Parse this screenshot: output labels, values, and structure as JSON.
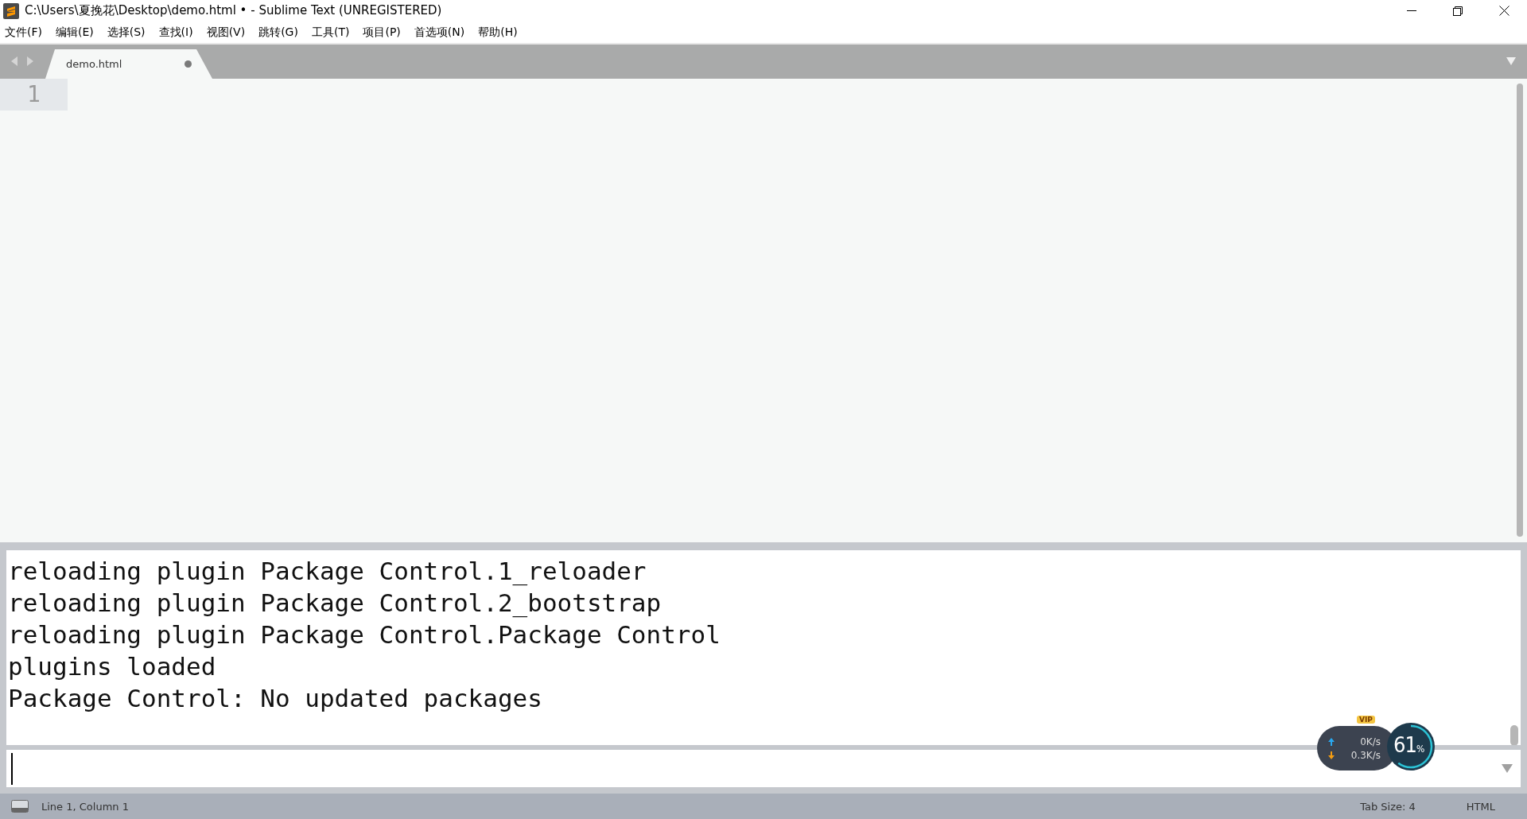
{
  "window": {
    "title": "C:\\Users\\夏挽花\\Desktop\\demo.html • - Sublime Text (UNREGISTERED)"
  },
  "menu": [
    "文件(F)",
    "编辑(E)",
    "选择(S)",
    "查找(I)",
    "视图(V)",
    "跳转(G)",
    "工具(T)",
    "项目(P)",
    "首选项(N)",
    "帮助(H)"
  ],
  "tabs": [
    {
      "label": "demo.html",
      "selected": true,
      "modified": true
    }
  ],
  "editor": {
    "line_numbers": [
      "1"
    ]
  },
  "console": {
    "lines": [
      "reloading plugin Package Control.1_reloader",
      "reloading plugin Package Control.2_bootstrap",
      "reloading plugin Package Control.Package Control",
      "plugins loaded",
      "Package Control: No updated packages"
    ]
  },
  "net_widget": {
    "badge": "VIP",
    "upload": "0K/s",
    "download": "0.3K/s",
    "percent": "61",
    "percent_sign": "%"
  },
  "status_bar": {
    "position": "Line 1, Column 1",
    "tab_size": "Tab Size: 4",
    "syntax": "HTML"
  }
}
